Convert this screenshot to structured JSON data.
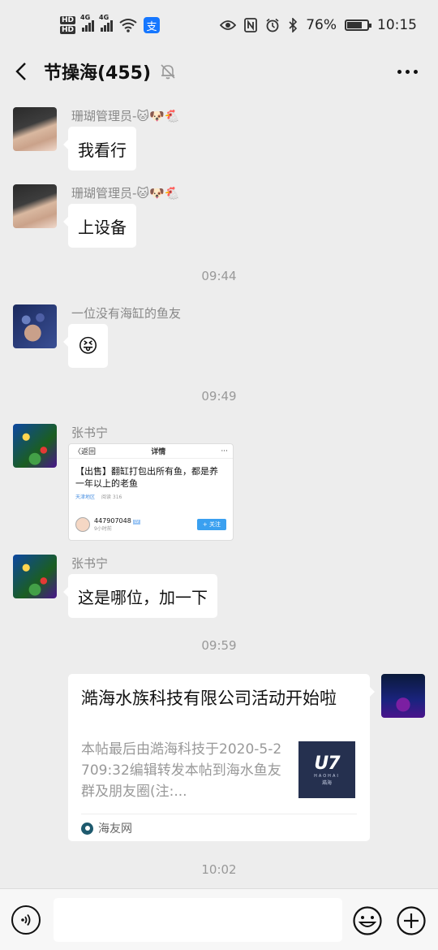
{
  "status_bar": {
    "hd_labels": [
      "HD",
      "HD"
    ],
    "network": "4G",
    "network2": "4G",
    "alipay_glyph": "支",
    "battery": "76%",
    "battery_level": 0.76,
    "time": "10:15"
  },
  "header": {
    "title": "节操海(455)",
    "icons": [
      "back-arrow-icon",
      "mute-bell-icon",
      "more-icon"
    ]
  },
  "messages": [
    {
      "sender": "珊瑚管理员-🐱🐶🐔",
      "text": "我看行"
    },
    {
      "sender": "珊瑚管理员-🐱🐶🐔",
      "text": "上设备"
    },
    {
      "time": "09:44"
    },
    {
      "sender": "一位没有海缸的鱼友",
      "text": "😝"
    },
    {
      "time": "09:49"
    },
    {
      "sender": "张书宁",
      "image_card": {
        "back": "〈返回",
        "header": "详情",
        "menu": "···",
        "body": "【出售】翻缸打包出所有鱼，都是养一年以上的老鱼",
        "meta_1": "天津地区",
        "meta_2": "阅读 316",
        "user": "447907048",
        "user_level": "LV",
        "user_time": "9小时前",
        "follow": "+ 关注"
      }
    },
    {
      "sender": "张书宁",
      "text": "这是哪位，加一下"
    },
    {
      "time": "09:59"
    },
    {
      "link_card": {
        "title": "澔海水族科技有限公司活动开始啦",
        "description": "本帖最后由澔海科技于2020-5-2709:32编辑转发本帖到海水鱼友群及朋友圈(注:...",
        "thumb_logo": "U7",
        "thumb_brand": "HAOHAI",
        "thumb_cn": "澔海",
        "source": "海友网"
      }
    },
    {
      "time": "10:02"
    }
  ],
  "input_bar": {
    "icons": [
      "voice-icon",
      "emoji-icon",
      "plus-icon"
    ]
  }
}
